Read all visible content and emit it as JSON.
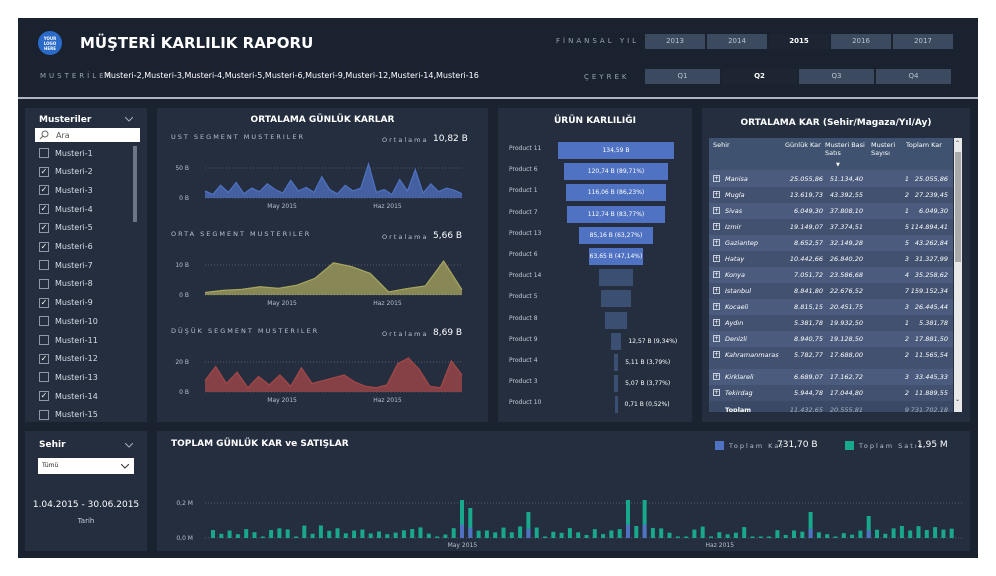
{
  "header": {
    "logo_text": "YOUR LOGO HERE",
    "title": "MÜŞTERİ KARLILIK RAPORU",
    "fin_year_label": "FİNANSAL YIL",
    "years": [
      "2013",
      "2014",
      "2015",
      "2016",
      "2017"
    ],
    "selected_year": "2015",
    "quarter_label": "ÇEYREK",
    "quarters": [
      "Q1",
      "Q2",
      "Q3",
      "Q4"
    ],
    "selected_quarter": "Q2",
    "customers_label": "MUSTERİLER",
    "customers_value": "Musteri-2,Musteri-3,Musteri-4,Musteri-5,Musteri-6,Musteri-9,Musteri-12,Musteri-14,Musteri-16"
  },
  "customers_filter": {
    "title": "Musteriler",
    "search_placeholder": "Ara",
    "items": [
      {
        "label": "Musteri-1",
        "checked": false
      },
      {
        "label": "Musteri-2",
        "checked": true
      },
      {
        "label": "Musteri-3",
        "checked": true
      },
      {
        "label": "Musteri-4",
        "checked": true
      },
      {
        "label": "Musteri-5",
        "checked": true
      },
      {
        "label": "Musteri-6",
        "checked": true
      },
      {
        "label": "Musteri-7",
        "checked": false
      },
      {
        "label": "Musteri-8",
        "checked": false
      },
      {
        "label": "Musteri-9",
        "checked": true
      },
      {
        "label": "Musteri-10",
        "checked": false
      },
      {
        "label": "Musteri-11",
        "checked": false
      },
      {
        "label": "Musteri-12",
        "checked": true
      },
      {
        "label": "Musteri-13",
        "checked": false
      },
      {
        "label": "Musteri-14",
        "checked": true
      },
      {
        "label": "Musteri-15",
        "checked": false
      }
    ]
  },
  "city_filter": {
    "title": "Sehir",
    "selected": "Tümü",
    "date_range": "1.04.2015 - 30.06.2015",
    "date_label": "Tarih"
  },
  "daily_profit": {
    "title": "ORTALAMA GÜNLÜK KARLAR",
    "avg_label": "Ortalama",
    "segments": [
      {
        "name": "UST SEGMENT MUSTERILER",
        "avg": "10,82 B",
        "yticks": [
          "50 B",
          "0 B"
        ],
        "xticks": [
          "May 2015",
          "Haz 2015"
        ],
        "color": "#4f72c2",
        "values": [
          10,
          5,
          18,
          8,
          22,
          6,
          14,
          9,
          20,
          12,
          7,
          25,
          10,
          15,
          8,
          30,
          12,
          6,
          18,
          10,
          14,
          48,
          8,
          12,
          5,
          26,
          10,
          40,
          7,
          20,
          9,
          14,
          11,
          6
        ]
      },
      {
        "name": "ORTA SEGMENT MUSTERILER",
        "avg": "5,66 B",
        "yticks": [
          "10 B",
          "0 B"
        ],
        "xticks": [
          "May 2015",
          "Haz 2015"
        ],
        "color": "#a9a760",
        "values": [
          1,
          1.8,
          2.2,
          3.2,
          2.6,
          3.8,
          6.5,
          12.5,
          11,
          8.4,
          1.2,
          2.5,
          3.5,
          13.2,
          2
        ]
      },
      {
        "name": "DÜŞÜK SEGMENT MUSTERILER",
        "avg": "8,69 B",
        "yticks": [
          "20 B",
          "0 B"
        ],
        "xticks": [
          "May 2015",
          "Haz 2015"
        ],
        "color": "#a54848",
        "values": [
          8,
          18,
          6,
          14,
          3,
          11,
          5,
          12,
          4,
          17,
          6,
          8,
          10,
          12,
          7,
          4,
          3,
          5,
          20,
          24,
          16,
          4,
          3,
          22,
          12
        ]
      }
    ]
  },
  "product_profit": {
    "title": "ÜRÜN KARLILIĞI",
    "items": [
      {
        "name": "Product 11",
        "value": 134.59,
        "label": "134,59 B"
      },
      {
        "name": "Product 6",
        "value": 120.74,
        "label": "120,74 B (89,71%)"
      },
      {
        "name": "Product 1",
        "value": 116.06,
        "label": "116,06 B (86,23%)"
      },
      {
        "name": "Product 7",
        "value": 112.74,
        "label": "112,74 B (83,77%)"
      },
      {
        "name": "Product 13",
        "value": 85.16,
        "label": "85,16 B (63,27%)"
      },
      {
        "name": "Product 6",
        "value": 63.65,
        "label": "63,65 B (47,14%)"
      },
      {
        "name": "Product 14",
        "value": 40,
        "label": ""
      },
      {
        "name": "Product 5",
        "value": 35,
        "label": ""
      },
      {
        "name": "Product 8",
        "value": 26,
        "label": ""
      },
      {
        "name": "Product 9",
        "value": 12.57,
        "label": "12,57 B (9,34%)"
      },
      {
        "name": "Product 4",
        "value": 5.11,
        "label": "5,11 B (3,79%)"
      },
      {
        "name": "Product 3",
        "value": 5.07,
        "label": "5,07 B (3,77%)"
      },
      {
        "name": "Product 10",
        "value": 0.71,
        "label": "0,71 B (0,52%)"
      }
    ]
  },
  "avg_profit_table": {
    "title": "ORTALAMA KAR (Sehir/Magaza/Yıl/Ay)",
    "headers": [
      "Sehir",
      "Günlük Kar",
      "Musteri Basi Satıs",
      "Musteri Sayısı",
      "Toplam Kar"
    ],
    "rows": [
      [
        "Manisa",
        "25.055,86",
        "51.134,40",
        "1",
        "25.055,86"
      ],
      [
        "Mugla",
        "13.619,73",
        "43.392,55",
        "2",
        "27.239,45"
      ],
      [
        "Sivas",
        "6.049,30",
        "37.808,10",
        "1",
        "6.049,30"
      ],
      [
        "Izmir",
        "19.149,07",
        "37.374,51",
        "5",
        "114.894,41"
      ],
      [
        "Gaziantep",
        "8.652,57",
        "32.149,28",
        "5",
        "43.262,84"
      ],
      [
        "Hatay",
        "10.442,66",
        "26.840,20",
        "3",
        "31.327,99"
      ],
      [
        "Konya",
        "7.051,72",
        "23.586,68",
        "4",
        "35.258,62"
      ],
      [
        "Istanbul",
        "8.841,80",
        "22.676,52",
        "7",
        "159.152,34"
      ],
      [
        "Kocaeli",
        "8.815,15",
        "20.451,75",
        "3",
        "26.445,44"
      ],
      [
        "Aydın",
        "5.381,78",
        "19.932,50",
        "1",
        "5.381,78"
      ],
      [
        "Denizli",
        "8.940,75",
        "19.128,50",
        "2",
        "17.881,50"
      ],
      [
        "Kahramanmaras",
        "5.782,77",
        "17.688,00",
        "2",
        "11.565,54"
      ],
      [
        "Kirklareli",
        "6.689,07",
        "17.162,72",
        "3",
        "33.445,33"
      ],
      [
        "Tekirdag",
        "5.944,78",
        "17.044,80",
        "2",
        "11.889,55"
      ]
    ],
    "total": [
      "Toplam",
      "11.432,65",
      "20.555,81",
      "9",
      "731.702,18"
    ]
  },
  "totals_chart": {
    "title": "TOPLAM GÜNLÜK KAR ve SATIŞLAR",
    "legend": [
      {
        "name": "Toplam Kar",
        "value": "731,70 B",
        "color": "#4f72c2"
      },
      {
        "name": "Toplam Satıs",
        "value": "1,95 M",
        "color": "#17a88e"
      }
    ],
    "yticks": [
      "0,2 M",
      "0,0 M"
    ],
    "xticks": [
      "May 2015",
      "Haz 2015"
    ]
  },
  "colors": {
    "accent_blue": "#4f72c2",
    "accent_teal": "#17a88e"
  }
}
